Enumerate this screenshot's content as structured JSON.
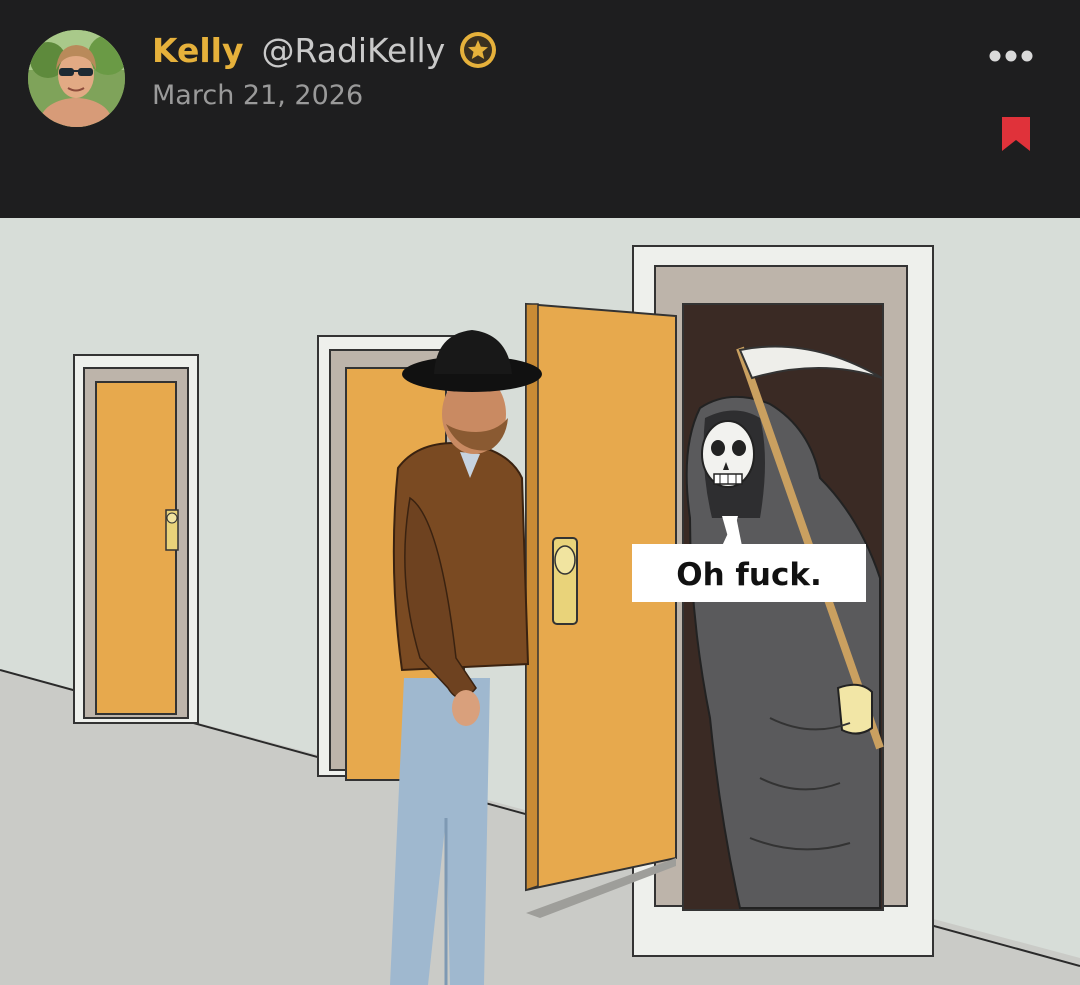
{
  "post": {
    "author": {
      "display_name": "Kelly",
      "handle": "@RadiKelly",
      "badge_icon": "star-badge-icon"
    },
    "date": "March 21, 2026",
    "actions": {
      "more_icon": "more-horizontal-icon",
      "bookmark_icon": "bookmark-icon"
    },
    "image": {
      "caption": "Oh fuck."
    }
  },
  "colors": {
    "background": "#1e1e1f",
    "author_name": "#e6b13b",
    "handle": "#c9c9c9",
    "date": "#9a9a9a",
    "bookmark": "#e0323a"
  }
}
